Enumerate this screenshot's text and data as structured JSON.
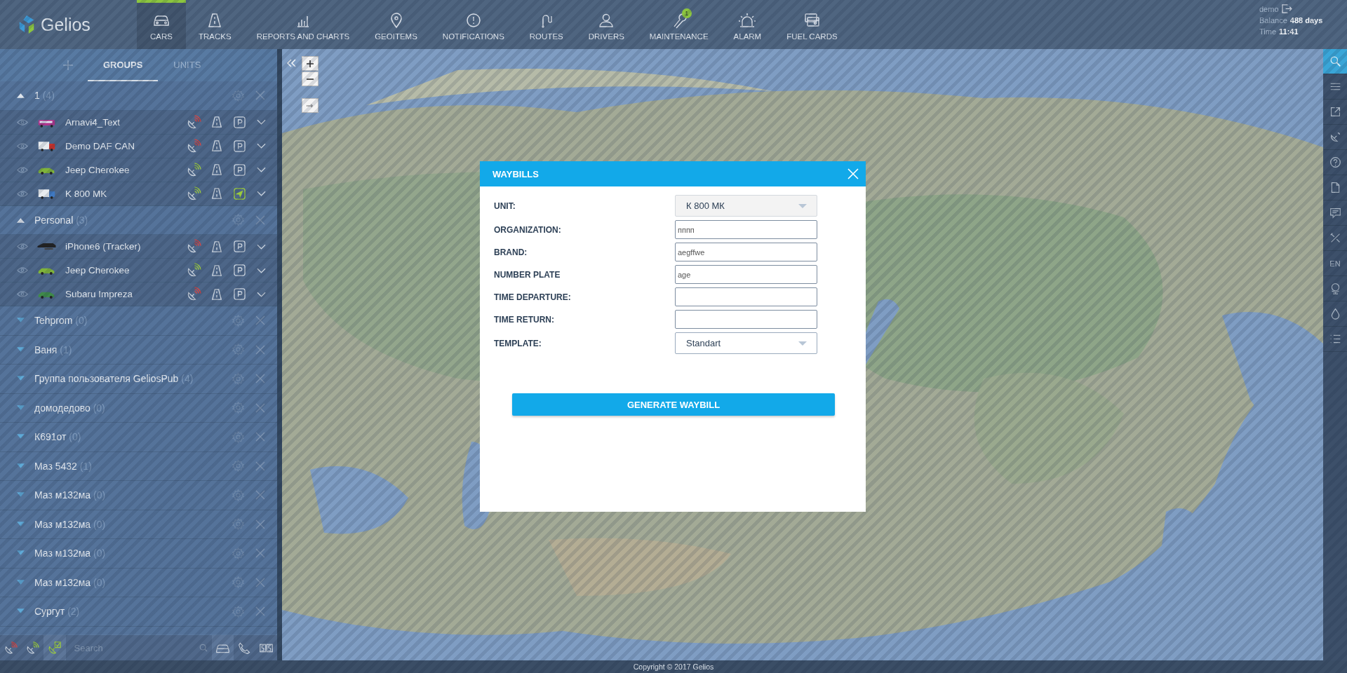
{
  "header": {
    "logo": "Gelios",
    "nav": [
      {
        "label": "CARS",
        "kind": "car",
        "selected": true
      },
      {
        "label": "TRACKS",
        "kind": "road",
        "selected": false
      },
      {
        "label": "REPORTS AND CHARTS",
        "kind": "chart",
        "selected": false
      },
      {
        "label": "GEOITEMS",
        "kind": "pin",
        "selected": false
      },
      {
        "label": "NOTIFICATIONS",
        "kind": "alert",
        "selected": false
      },
      {
        "label": "ROUTES",
        "kind": "route",
        "selected": false
      },
      {
        "label": "DRIVERS",
        "kind": "person",
        "selected": false
      },
      {
        "label": "MAINTENANCE",
        "kind": "wrench",
        "selected": false,
        "badge": "1"
      },
      {
        "label": "ALARM",
        "kind": "alarm",
        "selected": false
      },
      {
        "label": "FUEL CARDS",
        "kind": "cards",
        "selected": false
      }
    ],
    "user": {
      "name": "demo",
      "balance_label": "Balance",
      "balance": "488 days",
      "time_label": "Time",
      "time": "11:41"
    }
  },
  "sidebar": {
    "tabs": [
      {
        "label": "GROUPS",
        "selected": true
      },
      {
        "label": "UNITS",
        "selected": false
      }
    ],
    "groups": [
      {
        "name": "1",
        "count": "(4)",
        "expanded": true,
        "children": [
          {
            "name": "Arnavi4_Text",
            "kind": "bus",
            "color": "#b0368e",
            "online": false,
            "parked": true
          },
          {
            "name": "Demo DAF CAN",
            "kind": "truck",
            "color": "#c8322a",
            "online": false,
            "parked": true
          },
          {
            "name": "Jeep Cherokee",
            "kind": "car",
            "color": "#7fb33a",
            "online": true,
            "parked": true
          },
          {
            "name": "K 800 MK",
            "kind": "truck",
            "color": "#3f78c0",
            "online": true,
            "parked": false
          }
        ]
      },
      {
        "name": "Personal",
        "count": "(3)",
        "expanded": true,
        "children": [
          {
            "name": "iPhone6 (Tracker)",
            "kind": "phone",
            "color": "#222222",
            "online": false,
            "parked": true
          },
          {
            "name": "Jeep Cherokee",
            "kind": "car",
            "color": "#7fb33a",
            "online": true,
            "parked": true
          },
          {
            "name": "Subaru Impreza",
            "kind": "car",
            "color": "#3f8a4a",
            "online": false,
            "parked": true
          }
        ]
      },
      {
        "name": "Tehprom",
        "count": "(0)",
        "expanded": false
      },
      {
        "name": "Ваня",
        "count": "(1)",
        "expanded": false
      },
      {
        "name": "Группа пользователя GeliosPub",
        "count": "(4)",
        "expanded": false
      },
      {
        "name": "домодедово",
        "count": "(0)",
        "expanded": false
      },
      {
        "name": "К691от",
        "count": "(0)",
        "expanded": false
      },
      {
        "name": "Маз 5432",
        "count": "(1)",
        "expanded": false
      },
      {
        "name": "Маз м132ма",
        "count": "(0)",
        "expanded": false
      },
      {
        "name": "Маз м132ма",
        "count": "(0)",
        "expanded": false
      },
      {
        "name": "Маз м132ма",
        "count": "(0)",
        "expanded": false
      },
      {
        "name": "Маз м132ма",
        "count": "(0)",
        "expanded": false
      },
      {
        "name": "Сургут",
        "count": "(2)",
        "expanded": false
      }
    ],
    "filters": [
      {
        "kind": "offline",
        "selected": false
      },
      {
        "kind": "online",
        "selected": false
      },
      {
        "kind": "checked",
        "selected": true
      }
    ],
    "search": {
      "placeholder": "Search"
    },
    "type_filters": [
      {
        "kind": "car",
        "selected": true
      },
      {
        "kind": "phone",
        "selected": false
      },
      {
        "kind": "counter",
        "selected": false
      }
    ]
  },
  "right_toolbar": [
    {
      "kind": "search",
      "selected": true
    },
    {
      "kind": "menu",
      "selected": false
    },
    {
      "kind": "expand",
      "selected": false
    },
    {
      "kind": "satellite",
      "selected": false
    },
    {
      "kind": "help",
      "selected": false
    },
    {
      "kind": "document",
      "selected": false
    },
    {
      "kind": "chat",
      "selected": false
    },
    {
      "kind": "tools",
      "selected": false
    },
    {
      "kind": "language",
      "label": "EN",
      "selected": false
    },
    {
      "kind": "globe",
      "selected": false
    },
    {
      "kind": "drop",
      "selected": false
    },
    {
      "kind": "list",
      "selected": false
    }
  ],
  "modal": {
    "title": "WAYBILLS",
    "fields": [
      {
        "label": "UNIT:",
        "kind": "select",
        "value": "К 800 МК",
        "disabled": true
      },
      {
        "label": "ORGANIZATION:",
        "kind": "input",
        "value": "пппп"
      },
      {
        "label": "BRAND:",
        "kind": "input",
        "value": "aegffwe"
      },
      {
        "label": "NUMBER PLATE",
        "kind": "input",
        "value": "age"
      },
      {
        "label": "TIME DEPARTURE:",
        "kind": "input"
      },
      {
        "label": "TIME RETURN:",
        "kind": "input"
      },
      {
        "label": "TEMPLATE:",
        "kind": "select",
        "value": "Standart",
        "disabled": false
      }
    ],
    "button": "GENERATE WAYBILL"
  },
  "footer": "Copyright © 2017 Gelios"
}
